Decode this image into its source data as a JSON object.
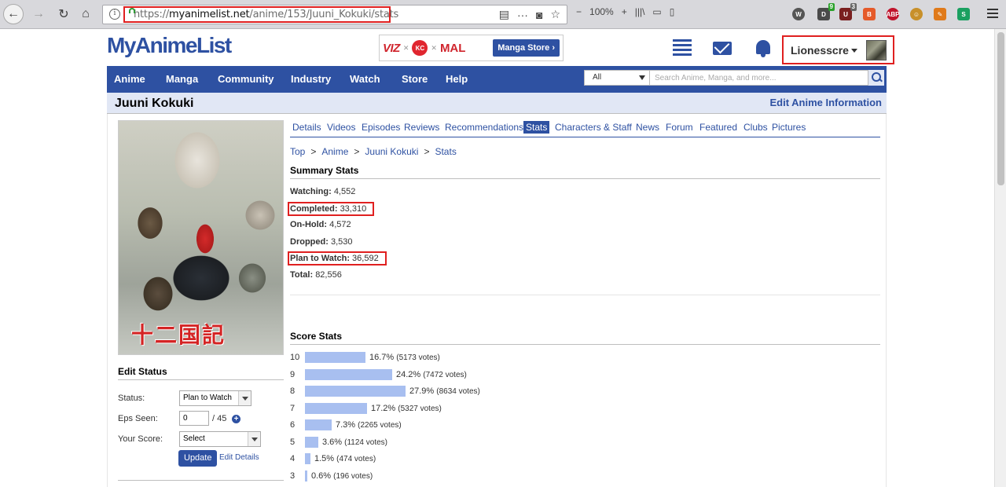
{
  "browser": {
    "url_scheme": "https://",
    "url_domain": "myanimelist.net",
    "url_path": "/anime/153/Juuni_Kokuki/stats",
    "zoom": "100%",
    "ext_badge_1": "9",
    "ext_badge_2": "3"
  },
  "site": {
    "logo": "MyAnimeList",
    "banner": {
      "viz": "VIZ",
      "kc": "KC",
      "mal": "MAL",
      "store": "Manga Store ›"
    },
    "username": "Lionesscre"
  },
  "nav": [
    "Anime",
    "Manga",
    "Community",
    "Industry",
    "Watch",
    "Store",
    "Help"
  ],
  "search": {
    "category": "All",
    "placeholder": "Search Anime, Manga, and more..."
  },
  "page": {
    "title": "Juuni Kokuki",
    "edit_info": "Edit Anime Information",
    "cover_text": "十二国記"
  },
  "tabs": [
    "Details",
    "Videos",
    "Episodes",
    "Reviews",
    "Recommendations",
    "Stats",
    "Characters & Staff",
    "News",
    "Forum",
    "Featured",
    "Clubs",
    "Pictures"
  ],
  "breadcrumb": [
    "Top",
    "Anime",
    "Juuni Kokuki",
    "Stats"
  ],
  "edit_status": {
    "heading": "Edit Status",
    "status_label": "Status:",
    "status_value": "Plan to Watch",
    "eps_label": "Eps Seen:",
    "eps_value": "0",
    "eps_total": "/ 45",
    "score_label": "Your Score:",
    "score_value": "Select",
    "update": "Update",
    "edit_details": "Edit Details"
  },
  "summary": {
    "heading": "Summary Stats",
    "items": [
      {
        "label": "Watching:",
        "value": "4,552"
      },
      {
        "label": "Completed:",
        "value": "33,310"
      },
      {
        "label": "On-Hold:",
        "value": "4,572"
      },
      {
        "label": "Dropped:",
        "value": "3,530"
      },
      {
        "label": "Plan to Watch:",
        "value": "36,592"
      },
      {
        "label": "Total:",
        "value": "82,556"
      }
    ]
  },
  "score_stats": {
    "heading": "Score Stats",
    "rows": [
      {
        "score": "10",
        "pct": "16.7%",
        "votes": "(5173 votes)",
        "fraction": 0.167
      },
      {
        "score": "9",
        "pct": "24.2%",
        "votes": "(7472 votes)",
        "fraction": 0.242
      },
      {
        "score": "8",
        "pct": "27.9%",
        "votes": "(8634 votes)",
        "fraction": 0.279
      },
      {
        "score": "7",
        "pct": "17.2%",
        "votes": "(5327 votes)",
        "fraction": 0.172
      },
      {
        "score": "6",
        "pct": "7.3%",
        "votes": "(2265 votes)",
        "fraction": 0.073
      },
      {
        "score": "5",
        "pct": "3.6%",
        "votes": "(1124 votes)",
        "fraction": 0.036
      },
      {
        "score": "4",
        "pct": "1.5%",
        "votes": "(474 votes)",
        "fraction": 0.015
      },
      {
        "score": "3",
        "pct": "0.6%",
        "votes": "(196 votes)",
        "fraction": 0.006
      }
    ]
  },
  "colors": {
    "brand": "#2e51a2",
    "highlight": "#e02020",
    "bar": "#a8bff0"
  }
}
